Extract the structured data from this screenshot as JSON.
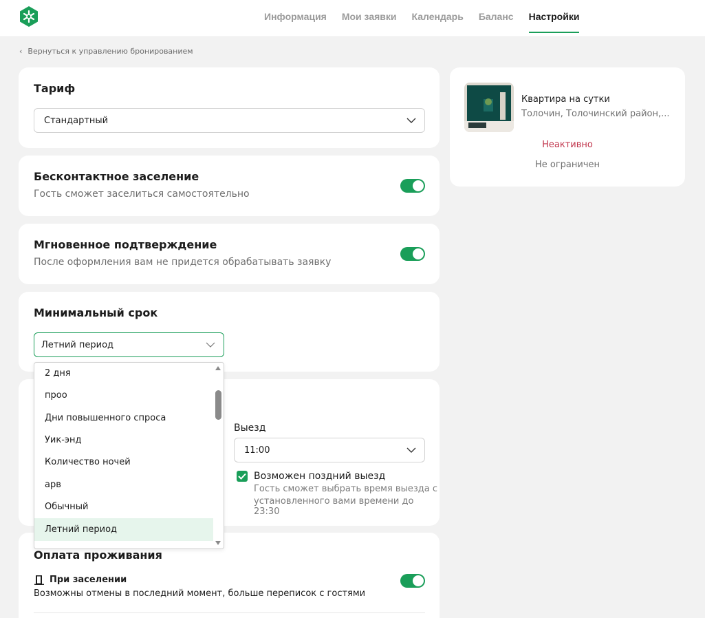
{
  "nav": {
    "items": [
      {
        "label": "Информация"
      },
      {
        "label": "Мои заявки"
      },
      {
        "label": "Календарь"
      },
      {
        "label": "Баланс"
      },
      {
        "label": "Настройки"
      }
    ],
    "active": "Настройки"
  },
  "back_link": "Вернуться к управлению бронированием",
  "tariff": {
    "title": "Тариф",
    "value": "Стандартный"
  },
  "contactless": {
    "title": "Бесконтактное заселение",
    "subtitle": "Гость сможет заселиться самостоятельно",
    "enabled": true
  },
  "instant": {
    "title": "Мгновенное подтверждение",
    "subtitle": "После оформления вам не придется обрабатывать заявку",
    "enabled": true
  },
  "min_term": {
    "title": "Минимальный срок",
    "value": "Летний период",
    "options": [
      "2 дня",
      "проо",
      "Дни повышенного спроса",
      "Уик-энд",
      "Количество ночей",
      "арв",
      "Обычный",
      "Летний период"
    ],
    "selected": "Летний период"
  },
  "checkout": {
    "label": "Выезд",
    "value": "11:00",
    "late_checkout": {
      "label": "Возможен поздний выезд",
      "description_line1": "Гость сможет выбрать время выезда с",
      "description_line2": "установленного вами времени до 23:30",
      "checked": true
    }
  },
  "payment": {
    "title": "Оплата проживания",
    "on_checkin": {
      "label": "При заселении",
      "description": "Возможны отмены в последний момент, больше переписок с гостями",
      "enabled": true
    }
  },
  "property": {
    "name": "Квартира на сутки",
    "address": "Толочин, Толочинский район,...",
    "status": "Неактивно",
    "limit": "Не ограничен"
  },
  "colors": {
    "accent": "#1a9e59",
    "status_inactive": "#c0334a",
    "background": "#f2f2f2"
  }
}
